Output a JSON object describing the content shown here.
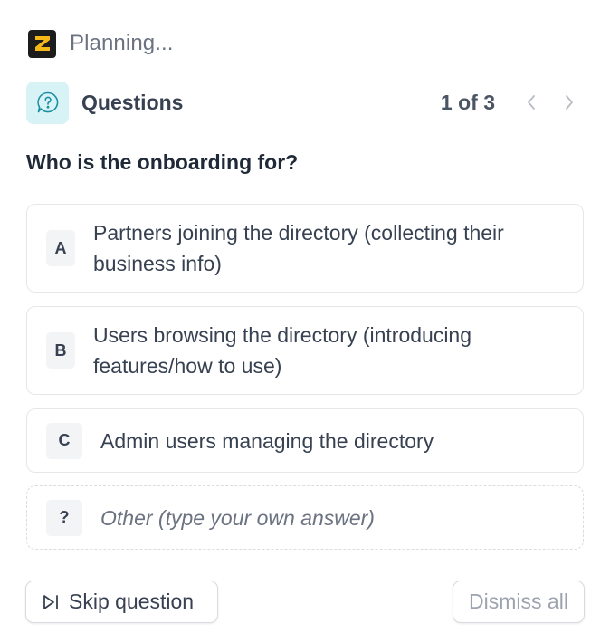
{
  "header": {
    "logo_letter": "Z",
    "status_text": "Planning..."
  },
  "questions": {
    "label": "Questions",
    "pager": "1 of 3",
    "icon_bg": "#d8f3f6",
    "icon_color": "#1a8fa3"
  },
  "question": {
    "title": "Who is the onboarding for?",
    "options": [
      {
        "key": "A",
        "line1": "Partners joining the directory (collecting their",
        "line2": "business info)"
      },
      {
        "key": "B",
        "line1": "Users browsing the directory (introducing",
        "line2": "features/how to use)"
      },
      {
        "key": "C",
        "text": "Admin users managing the directory"
      }
    ],
    "other": {
      "key": "?",
      "placeholder": "Other (type your own answer)"
    }
  },
  "footer": {
    "skip_label": "Skip question",
    "dismiss_label": "Dismiss all"
  },
  "icons": {
    "logo": "z-logo-icon",
    "question": "question-chat-icon",
    "prev": "chevron-left-icon",
    "next": "chevron-right-icon",
    "skip": "skip-forward-icon"
  }
}
